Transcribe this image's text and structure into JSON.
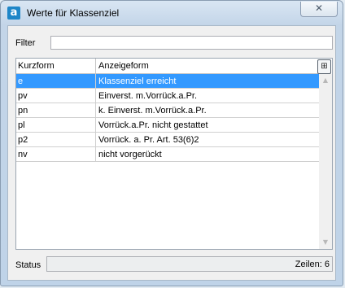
{
  "window": {
    "title": "Werte für Klassenziel",
    "app_icon_letter": "a",
    "close_glyph": "✕"
  },
  "filter": {
    "label": "Filter",
    "value": "",
    "placeholder": ""
  },
  "grid": {
    "columns": [
      "Kurzform",
      "Anzeigeform"
    ],
    "chooser_glyph": "⊞",
    "rows": [
      {
        "kurzform": "e",
        "anzeigeform": "Klassenziel erreicht",
        "selected": true
      },
      {
        "kurzform": "pv",
        "anzeigeform": "Einverst. m.Vorrück.a.Pr.",
        "selected": false
      },
      {
        "kurzform": "pn",
        "anzeigeform": "k. Einverst. m.Vorrück.a.Pr.",
        "selected": false
      },
      {
        "kurzform": "pl",
        "anzeigeform": "Vorrück.a.Pr. nicht gestattet",
        "selected": false
      },
      {
        "kurzform": "p2",
        "anzeigeform": "Vorrück. a. Pr. Art. 53(6)2",
        "selected": false
      },
      {
        "kurzform": "nv",
        "anzeigeform": "nicht vorgerückt",
        "selected": false
      }
    ]
  },
  "status": {
    "label": "Status",
    "count_text": "Zeilen: 6"
  },
  "colors": {
    "selection": "#3399ff",
    "app_icon": "#1e86c8"
  }
}
